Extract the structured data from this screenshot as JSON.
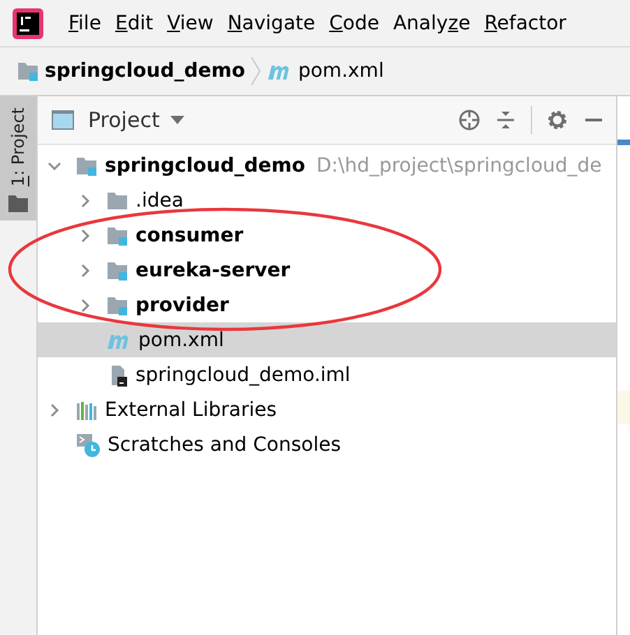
{
  "menu": [
    {
      "mnemonic": "F",
      "after": "ile"
    },
    {
      "mnemonic": "E",
      "after": "dit"
    },
    {
      "mnemonic": "V",
      "after": "iew"
    },
    {
      "mnemonic": "N",
      "after": "avigate"
    },
    {
      "mnemonic": "C",
      "after": "ode"
    },
    {
      "before": "Analy",
      "mnemonic": "z",
      "after": "e"
    },
    {
      "mnemonic": "R",
      "after": "efactor"
    }
  ],
  "breadcrumb": [
    {
      "kind": "module",
      "label": "springcloud_demo"
    },
    {
      "kind": "maven",
      "label": "pom.xml"
    }
  ],
  "side_tab": {
    "mnemonic": "1",
    "after": ": Project",
    "selected": true
  },
  "panel": {
    "title": "Project"
  },
  "tree": [
    {
      "kind": "module",
      "label": "springcloud_demo",
      "path": "D:\\hd_project\\springcloud_de",
      "bold": true,
      "expanded": true,
      "selected": false,
      "children": [
        {
          "kind": "folder",
          "label": ".idea",
          "bold": false,
          "expanded": false,
          "selected": false
        },
        {
          "kind": "module",
          "label": "consumer",
          "bold": true,
          "expanded": false,
          "selected": false
        },
        {
          "kind": "module",
          "label": "eureka-server",
          "bold": true,
          "expanded": false,
          "selected": false
        },
        {
          "kind": "module",
          "label": "provider",
          "bold": true,
          "expanded": false,
          "selected": false
        },
        {
          "kind": "maven",
          "label": "pom.xml",
          "bold": false,
          "selected": true
        },
        {
          "kind": "iml",
          "label": "springcloud_demo.iml",
          "bold": false,
          "selected": false
        }
      ]
    },
    {
      "kind": "library",
      "label": "External Libraries",
      "bold": false,
      "expanded": false,
      "selected": false
    },
    {
      "kind": "scratch",
      "label": "Scratches and Consoles",
      "bold": false,
      "selected": false
    }
  ]
}
